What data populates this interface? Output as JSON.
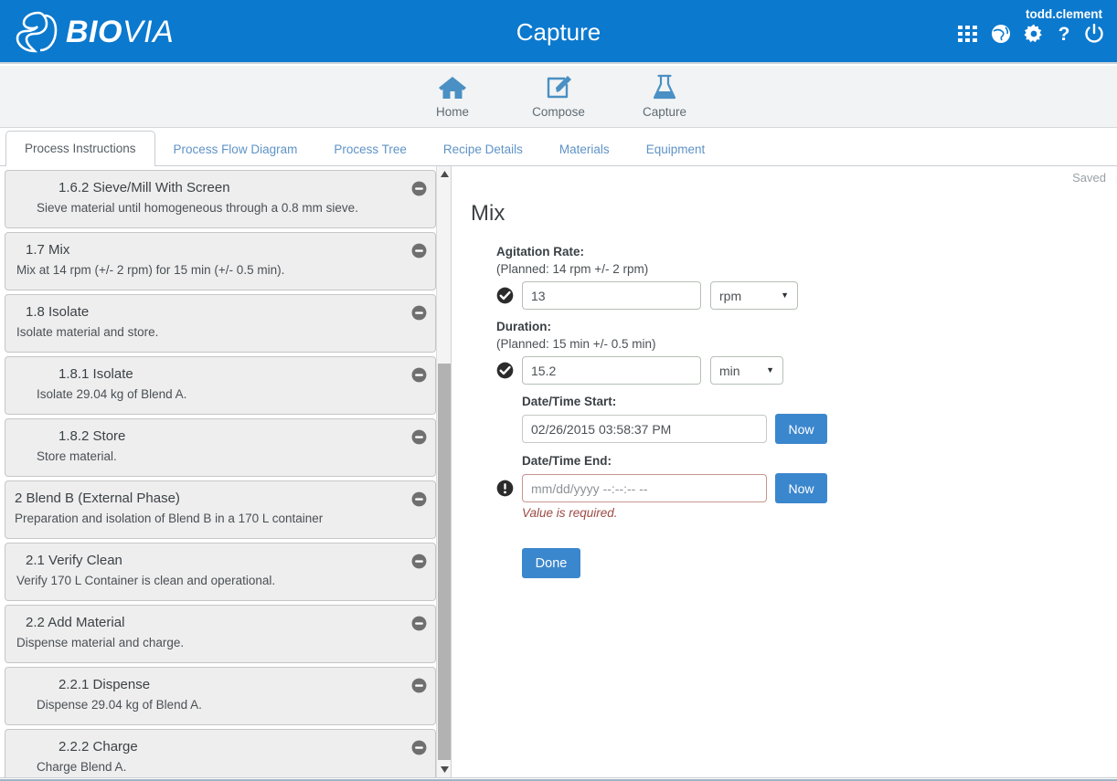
{
  "header": {
    "logo_text_bold": "BIO",
    "logo_text_thin": "VIA",
    "logo_mark": "3ds-logo-icon",
    "app_title": "Capture",
    "user_name": "todd.clement",
    "brand_color": "#0b79ce",
    "icons": [
      {
        "name": "apps-grid-icon",
        "label": "Apps"
      },
      {
        "name": "globe-icon",
        "label": "Language"
      },
      {
        "name": "gear-icon",
        "label": "Settings"
      },
      {
        "name": "help-icon",
        "label": "Help"
      },
      {
        "name": "power-icon",
        "label": "Log Out"
      }
    ]
  },
  "subnav": {
    "items": [
      {
        "label": "Home",
        "icon": "home-icon"
      },
      {
        "label": "Compose",
        "icon": "compose-pencil-icon"
      },
      {
        "label": "Capture",
        "icon": "flask-icon"
      }
    ]
  },
  "tabs": [
    {
      "label": "Process Instructions",
      "active": true
    },
    {
      "label": "Process Flow Diagram",
      "active": false
    },
    {
      "label": "Process Tree",
      "active": false
    },
    {
      "label": "Recipe Details",
      "active": false
    },
    {
      "label": "Materials",
      "active": false
    },
    {
      "label": "Equipment",
      "active": false
    }
  ],
  "steps": [
    {
      "title": "1.6.2 Sieve/Mill With Screen",
      "desc": "Sieve material until homogeneous through a 0.8 mm sieve.",
      "level": 3,
      "collapse_icon": "minus-circle-icon"
    },
    {
      "title": "1.7 Mix",
      "desc": "Mix at 14 rpm (+/- 2 rpm) for 15 min (+/- 0.5 min).",
      "level": 2,
      "collapse_icon": "minus-circle-icon"
    },
    {
      "title": "1.8 Isolate",
      "desc": "Isolate material and store.",
      "level": 2,
      "collapse_icon": "minus-circle-icon"
    },
    {
      "title": "1.8.1 Isolate",
      "desc": "Isolate 29.04 kg of Blend A.",
      "level": 3,
      "collapse_icon": "minus-circle-icon"
    },
    {
      "title": "1.8.2 Store",
      "desc": "Store material.",
      "level": 3,
      "collapse_icon": "minus-circle-icon"
    },
    {
      "title": "2 Blend B (External Phase)",
      "desc": "Preparation and isolation of Blend B in a 170 L container",
      "level": 1,
      "collapse_icon": "minus-circle-icon"
    },
    {
      "title": "2.1 Verify Clean",
      "desc": "Verify 170 L Container is clean and operational.",
      "level": 2,
      "collapse_icon": "minus-circle-icon"
    },
    {
      "title": "2.2 Add Material",
      "desc": "Dispense material and charge.",
      "level": 2,
      "collapse_icon": "minus-circle-icon"
    },
    {
      "title": "2.2.1 Dispense",
      "desc": "Dispense 29.04 kg of Blend A.",
      "level": 3,
      "collapse_icon": "minus-circle-icon"
    },
    {
      "title": "2.2.2 Charge",
      "desc": "Charge Blend A.",
      "level": 3,
      "collapse_icon": "minus-circle-icon"
    }
  ],
  "scrollbar": {
    "up_icon": "scroll-up-arrow-icon",
    "down_icon": "scroll-down-arrow-icon"
  },
  "detail": {
    "save_status": "Saved",
    "title": "Mix",
    "agitation": {
      "label": "Agitation Rate:",
      "planned": "(Planned: 14 rpm +/- 2 rpm)",
      "value": "13",
      "unit": "rpm",
      "status_icon": "check-circle-icon"
    },
    "duration": {
      "label": "Duration:",
      "planned": "(Planned: 15 min +/- 0.5 min)",
      "value": "15.2",
      "unit": "min",
      "status_icon": "check-circle-icon"
    },
    "date_start": {
      "label": "Date/Time Start:",
      "value": "02/26/2015 03:58:37 PM",
      "now_label": "Now"
    },
    "date_end": {
      "label": "Date/Time End:",
      "value": "",
      "placeholder": "mm/dd/yyyy --:--:-- --",
      "now_label": "Now",
      "error": "Value is required.",
      "status_icon": "exclamation-circle-icon",
      "error_color": "#9c4a44"
    },
    "done_label": "Done"
  }
}
